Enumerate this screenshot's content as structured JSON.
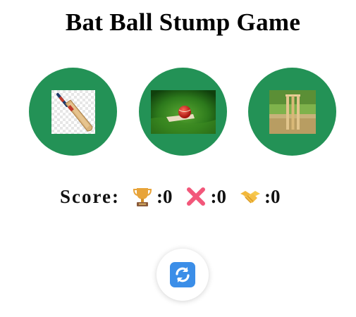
{
  "title": "Bat Ball Stump Game",
  "choices": [
    {
      "name": "bat",
      "icon": "cricket-bat-icon"
    },
    {
      "name": "ball",
      "icon": "cricket-ball-icon"
    },
    {
      "name": "stump",
      "icon": "stumps-icon"
    }
  ],
  "score": {
    "label": "Score:",
    "win_icon": "trophy-icon",
    "win": ":0",
    "loss_icon": "cross-mark-icon",
    "loss": ":0",
    "tie_icon": "handshake-icon",
    "tie": ":0"
  },
  "reset_icon": "refresh-icon",
  "colors": {
    "choice_bg": "#239256",
    "reset_bg": "#ffffff",
    "refresh_blue": "#3b8ee8"
  }
}
